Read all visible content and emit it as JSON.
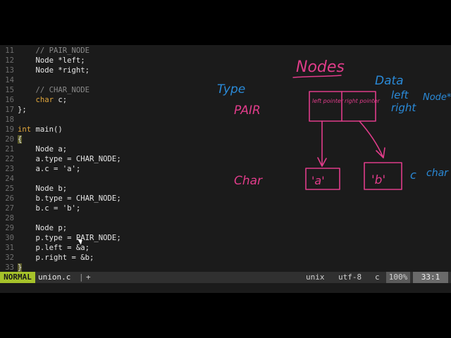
{
  "editor": {
    "lines": [
      {
        "num": "11",
        "code": "    // PAIR_NODE",
        "style": "comment"
      },
      {
        "num": "12",
        "code": "    Node *left;"
      },
      {
        "num": "13",
        "code": "    Node *right;"
      },
      {
        "num": "14",
        "code": ""
      },
      {
        "num": "15",
        "code": "    // CHAR_NODE",
        "style": "comment"
      },
      {
        "num": "16",
        "code": "    char c;",
        "kw": "char"
      },
      {
        "num": "17",
        "code": "};"
      },
      {
        "num": "18",
        "code": ""
      },
      {
        "num": "19",
        "code": "int main()",
        "kw": "int"
      },
      {
        "num": "20",
        "code": "{",
        "style": "brace"
      },
      {
        "num": "21",
        "code": "    Node a;"
      },
      {
        "num": "22",
        "code": "    a.type = CHAR_NODE;"
      },
      {
        "num": "23",
        "code": "    a.c = 'a';"
      },
      {
        "num": "24",
        "code": ""
      },
      {
        "num": "25",
        "code": "    Node b;"
      },
      {
        "num": "26",
        "code": "    b.type = CHAR_NODE;"
      },
      {
        "num": "27",
        "code": "    b.c = 'b';"
      },
      {
        "num": "28",
        "code": ""
      },
      {
        "num": "29",
        "code": "    Node p;"
      },
      {
        "num": "30",
        "code": "    p.type = PAIR_NODE;"
      },
      {
        "num": "31",
        "code": "    p.left = &a;"
      },
      {
        "num": "32",
        "code": "    p.right = &b;"
      },
      {
        "num": "33",
        "code": "}",
        "style": "brace"
      }
    ]
  },
  "statusbar": {
    "mode": "NORMAL",
    "filename": "union.c",
    "separator": "|",
    "plus": "+",
    "fileformat": "unix",
    "encoding": "utf-8",
    "filetype": "c",
    "percent": "100%",
    "position": "33:1"
  },
  "annotations": {
    "title": "Nodes",
    "data_label": "Data",
    "type_label": "Type",
    "pair_label": "PAIR",
    "char_label": "Char",
    "left_label": "left",
    "right_label": "right",
    "nodes_label": "Node*",
    "c_label": "c",
    "char_label2": "char",
    "box_left_text": "left pointer",
    "box_right_text": "right pointer",
    "box_a_text": "'a'",
    "box_b_text": "'b'",
    "colors": {
      "pink": "#e03c8a",
      "blue": "#2a8ad8"
    }
  }
}
